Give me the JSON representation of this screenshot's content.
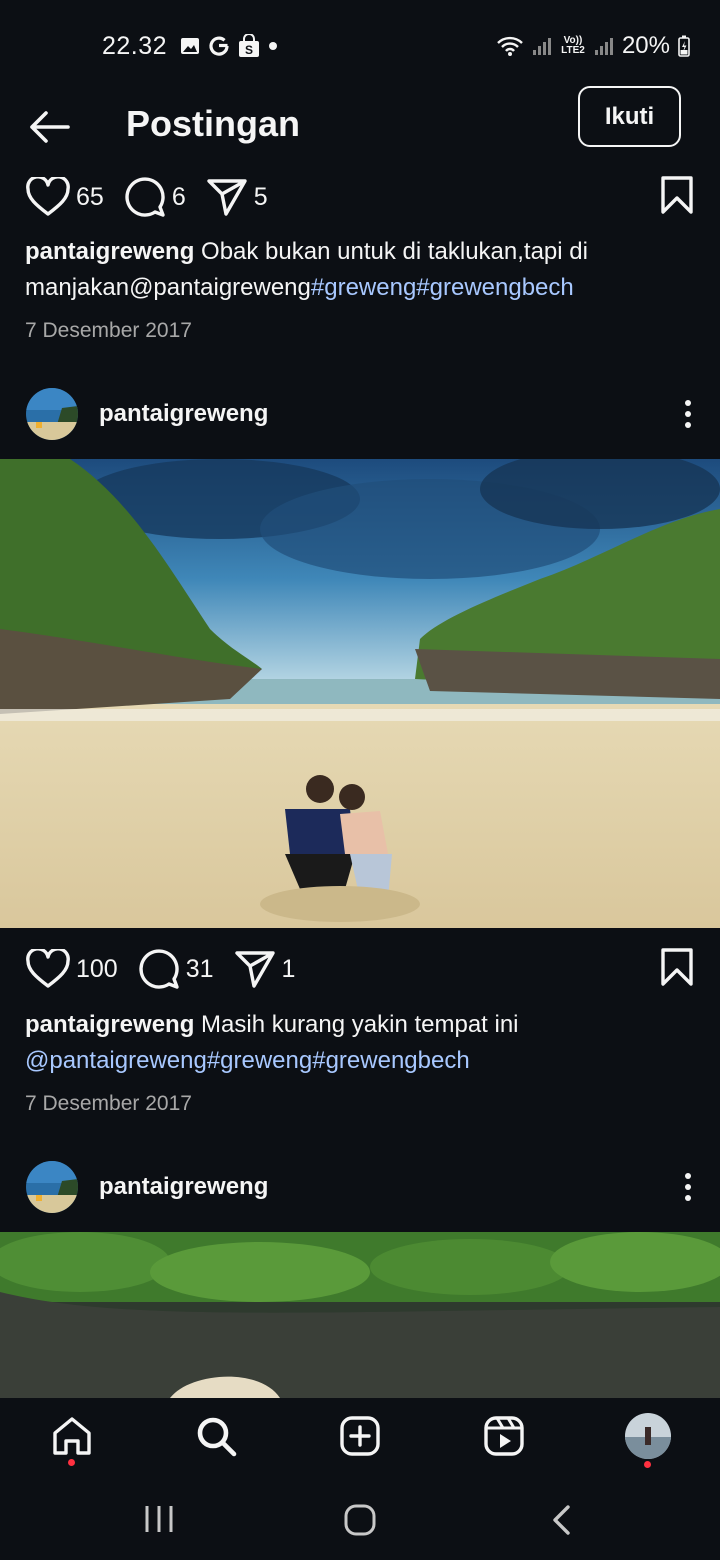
{
  "status_bar": {
    "time": "22.32",
    "battery": "20%",
    "network_label": "Vo)) LTE2"
  },
  "header": {
    "title": "Postingan",
    "follow_label": "Ikuti"
  },
  "posts": [
    {
      "likes": "65",
      "comments": "6",
      "shares": "5",
      "caption_user": "pantaigreweng",
      "caption_text": " Obak bukan untuk di taklukan,tapi di manjakan@pantaigreweng",
      "caption_links": "#greweng#grewengbech",
      "date": "7 Desember 2017"
    },
    {
      "author": "pantaigreweng",
      "likes": "100",
      "comments": "31",
      "shares": "1",
      "caption_user": "pantaigreweng",
      "caption_text": " Masih kurang yakin tempat ini",
      "caption_links": "@pantaigreweng#greweng#grewengbech",
      "date": "7 Desember 2017"
    },
    {
      "author": "pantaigreweng"
    }
  ],
  "bottom_nav": {
    "items": [
      "home-icon",
      "search-icon",
      "create-icon",
      "reels-icon",
      "profile-avatar"
    ],
    "notification_color": "#ff3040"
  },
  "colors": {
    "background": "#0c0f14",
    "text": "#f5f5f5",
    "link": "#a8c8ff",
    "muted": "#a8a8a8"
  }
}
